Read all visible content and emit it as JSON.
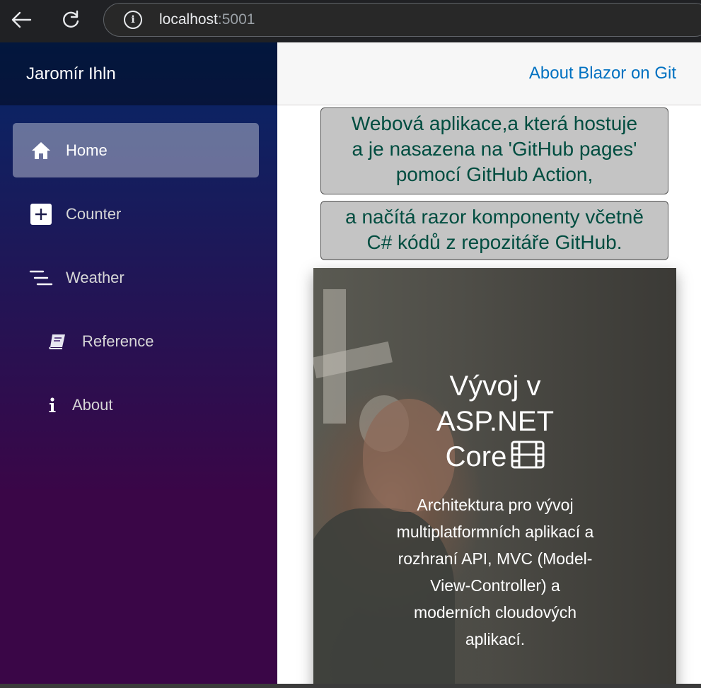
{
  "browser": {
    "url_host": "localhost",
    "url_port": ":5001"
  },
  "sidebar": {
    "brand": "Jaromír Ihln",
    "items": [
      {
        "label": "Home",
        "icon": "home-icon",
        "active": true
      },
      {
        "label": "Counter",
        "icon": "plus-square-icon",
        "active": false
      },
      {
        "label": "Weather",
        "icon": "list-lines-icon",
        "active": false
      },
      {
        "label": "Reference",
        "icon": "book-icon",
        "active": false
      },
      {
        "label": "About",
        "icon": "info-icon",
        "active": false
      }
    ]
  },
  "top_row": {
    "link": "About Blazor on Git"
  },
  "main": {
    "bubble1_line1": "Webová aplikace,a která hostuje",
    "bubble1_line2": "a je nasazena na 'GitHub pages'",
    "bubble1_line3": "pomocí GitHub Action,",
    "bubble2_line1": "a načítá razor komponenty včetně",
    "bubble2_line2": "C# kódů z repozitáře GitHub.",
    "hero": {
      "title_line1": "Vývoj v",
      "title_line2": "ASP.NET",
      "title_line3": "Core",
      "title_icon": "film-icon",
      "subtitle": "Architektura pro vývoj multiplatformních aplikací a rozhraní API, MVC (Model-View-Controller) a moderních cloudových aplikací."
    }
  },
  "colors": {
    "accent_link": "#0071c1",
    "bubble_text": "#004d40",
    "sidebar_top": "#052767",
    "sidebar_bottom": "#3a0647"
  }
}
